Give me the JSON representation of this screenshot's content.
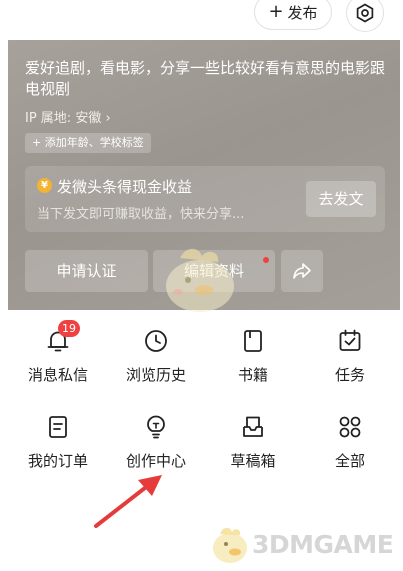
{
  "header": {
    "publish_label": "发布",
    "publish_icon": "plus-icon",
    "settings_icon": "gear-icon"
  },
  "profile": {
    "bio": "爱好追剧，看电影，分享一些比较好看有意思的电影跟电视剧",
    "ip_location": "IP 属地: 安徽",
    "ip_chevron": "›",
    "add_tags_label": "+ 添加年龄、学校标签"
  },
  "earnings_card": {
    "icon": "yuan-coin-icon",
    "coin_glyph": "¥",
    "title": "发微头条得现金收益",
    "subtitle": "当下发文即可赚取收益，快来分享...",
    "button_label": "去发文"
  },
  "actions": {
    "apply_label": "申请认证",
    "edit_label": "编辑资料",
    "share_icon": "share-icon"
  },
  "menu": {
    "items": [
      {
        "label": "消息私信",
        "icon": "bell-icon",
        "badge": "19"
      },
      {
        "label": "浏览历史",
        "icon": "clock-icon"
      },
      {
        "label": "书籍",
        "icon": "book-icon"
      },
      {
        "label": "任务",
        "icon": "calendar-check-icon"
      },
      {
        "label": "我的订单",
        "icon": "order-doc-icon"
      },
      {
        "label": "创作中心",
        "icon": "lightbulb-icon"
      },
      {
        "label": "草稿箱",
        "icon": "draft-box-icon"
      },
      {
        "label": "全部",
        "icon": "grid-dots-icon"
      }
    ]
  },
  "overlay": {
    "watermark_text": "3DMGAME",
    "annotation": "red-arrow-pointing-to-创作中心"
  },
  "colors": {
    "accent_red": "#f04142",
    "coin_gold": "#f2b431",
    "watermark_gray": "#d6d6d6"
  }
}
